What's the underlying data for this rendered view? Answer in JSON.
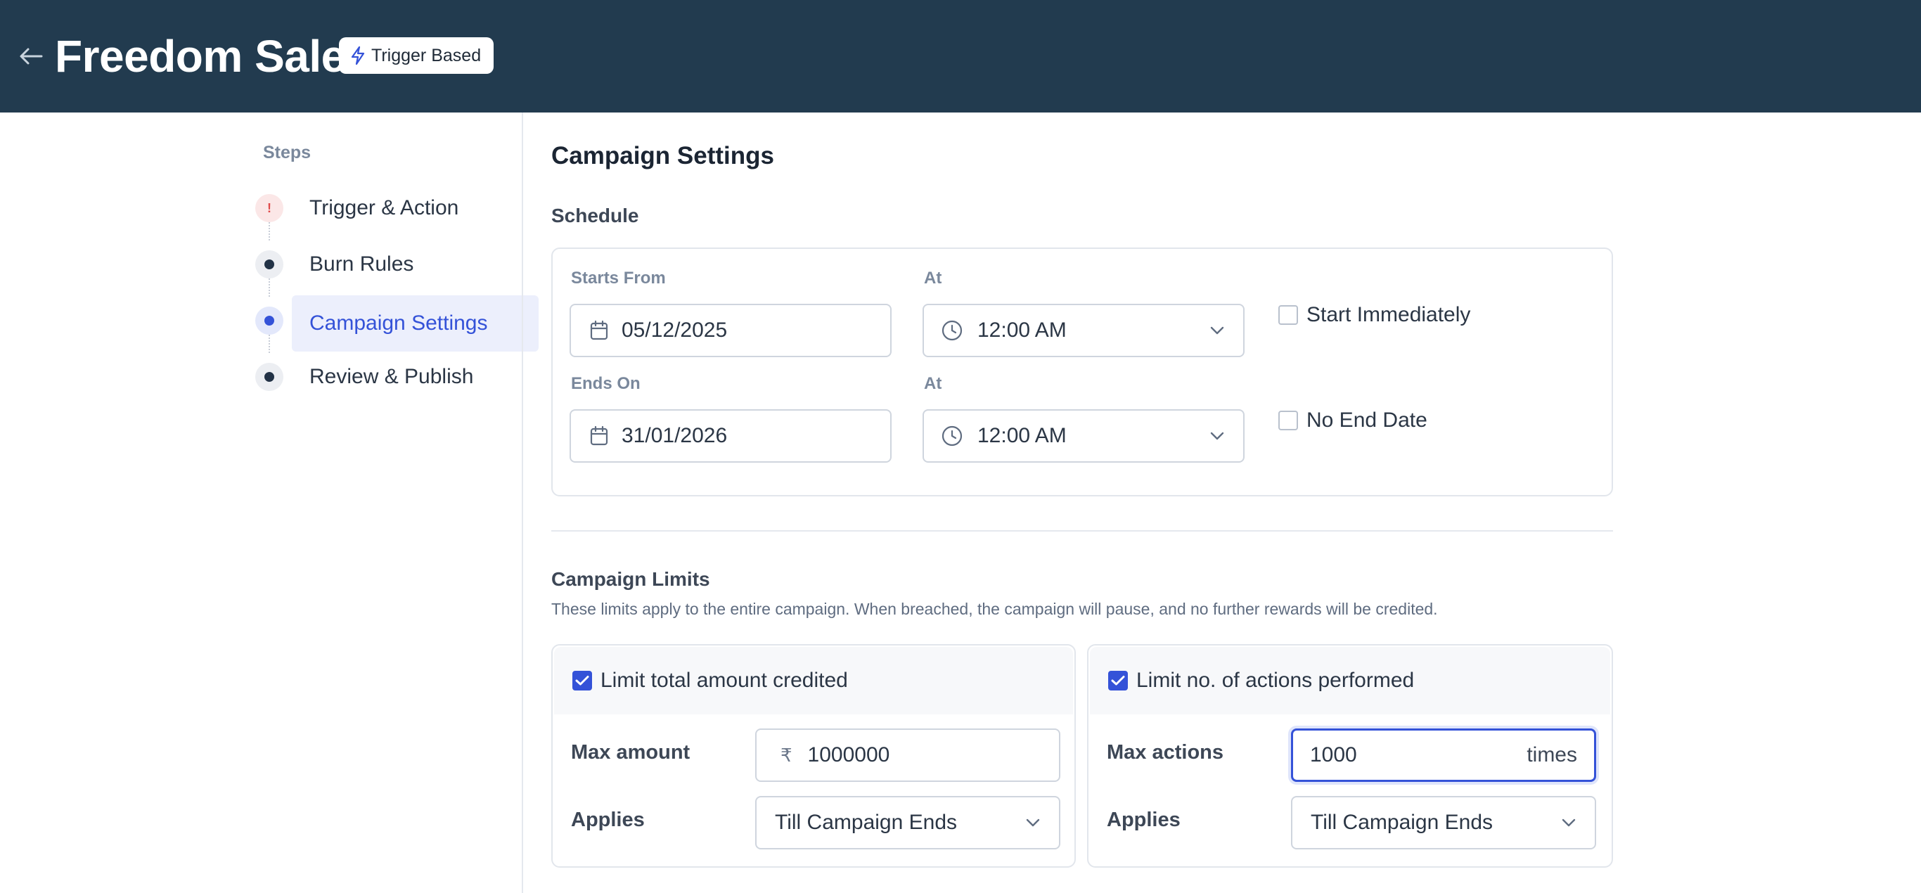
{
  "header": {
    "title": "Freedom Sale",
    "badge": "Trigger Based"
  },
  "steps": {
    "heading": "Steps",
    "items": [
      {
        "label": "Trigger & Action",
        "state": "error"
      },
      {
        "label": "Burn Rules",
        "state": "done"
      },
      {
        "label": "Campaign Settings",
        "state": "active"
      },
      {
        "label": "Review & Publish",
        "state": "done"
      }
    ]
  },
  "main": {
    "title": "Campaign Settings",
    "schedule": {
      "title": "Schedule",
      "starts_from_label": "Starts From",
      "starts_from_value": "05/12/2025",
      "start_at_label": "At",
      "start_at_value": "12:00 AM",
      "start_immediately_label": "Start Immediately",
      "ends_on_label": "Ends On",
      "ends_on_value": "31/01/2026",
      "end_at_label": "At",
      "end_at_value": "12:00 AM",
      "no_end_date_label": "No End Date"
    },
    "limits": {
      "title": "Campaign Limits",
      "description": "These limits apply to the entire campaign. When breached, the campaign will pause, and no further rewards will be credited.",
      "amount": {
        "checkbox_label": "Limit total amount credited",
        "max_label": "Max amount",
        "currency": "₹",
        "max_value": "1000000",
        "applies_label": "Applies",
        "applies_value": "Till Campaign Ends"
      },
      "actions": {
        "checkbox_label": "Limit no. of actions performed",
        "max_label": "Max actions",
        "max_value": "1000",
        "suffix": "times",
        "applies_label": "Applies",
        "applies_value": "Till Campaign Ends"
      }
    }
  },
  "colors": {
    "header_bg": "#223b4f",
    "accent": "#3452d8",
    "error": "#e04a4a"
  }
}
